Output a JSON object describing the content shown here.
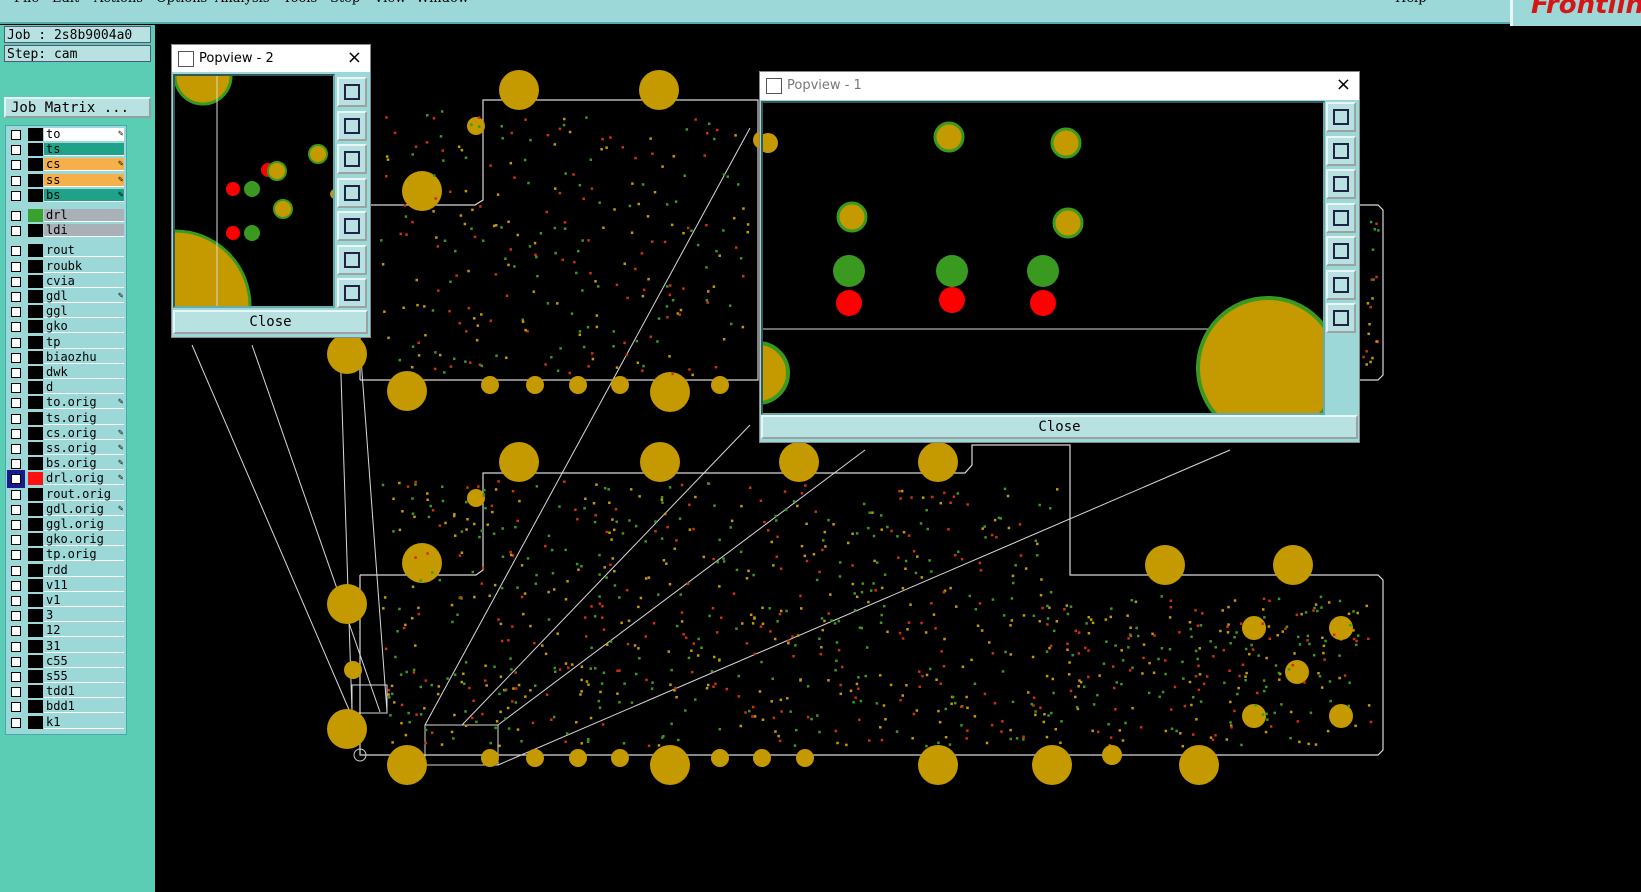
{
  "menu": {
    "items": [
      "File",
      "Edit",
      "Actions",
      "Options",
      "Analysis",
      "Tools",
      "Step",
      "View",
      "Window"
    ],
    "help": "Help"
  },
  "logo": "Frontline",
  "job": {
    "label": "Job : 2s8b9004a0",
    "step": "Step: cam",
    "matrix_button": "Job Matrix ..."
  },
  "layers": [
    {
      "name": "to",
      "color": "#ffffff",
      "edit": true
    },
    {
      "name": "ts",
      "color": "#1ea38a",
      "edit": false
    },
    {
      "name": "cs",
      "color": "#f6b04a",
      "edit": true
    },
    {
      "name": "ss",
      "color": "#f6b04a",
      "edit": true
    },
    {
      "name": "bs",
      "color": "#1ea38a",
      "edit": true
    },
    {
      "name": "drl",
      "color": "#aab0b8",
      "swatch": "#3aa030",
      "edit": false,
      "gap": true
    },
    {
      "name": "ldi",
      "color": "#aab0b8",
      "edit": false
    },
    {
      "name": "rout",
      "color": "#9dd8d8",
      "edit": false,
      "gap": true
    },
    {
      "name": "roubk",
      "color": "#9dd8d8",
      "edit": false
    },
    {
      "name": "cvia",
      "color": "#9dd8d8",
      "edit": false
    },
    {
      "name": "gdl",
      "color": "#9dd8d8",
      "edit": true
    },
    {
      "name": "ggl",
      "color": "#9dd8d8",
      "edit": false
    },
    {
      "name": "gko",
      "color": "#9dd8d8",
      "edit": false
    },
    {
      "name": "tp",
      "color": "#9dd8d8",
      "edit": false
    },
    {
      "name": "biaozhu",
      "color": "#9dd8d8",
      "edit": false
    },
    {
      "name": "dwk",
      "color": "#9dd8d8",
      "edit": false
    },
    {
      "name": "d",
      "color": "#9dd8d8",
      "edit": false
    },
    {
      "name": "to.orig",
      "color": "#9dd8d8",
      "edit": true
    },
    {
      "name": "ts.orig",
      "color": "#9dd8d8",
      "edit": false
    },
    {
      "name": "cs.orig",
      "color": "#9dd8d8",
      "edit": true
    },
    {
      "name": "ss.orig",
      "color": "#9dd8d8",
      "edit": true
    },
    {
      "name": "bs.orig",
      "color": "#9dd8d8",
      "edit": true
    },
    {
      "name": "drl.orig",
      "color": "#9dd8d8",
      "swatch": "#ff1010",
      "edit": true,
      "active": true
    },
    {
      "name": "rout.orig",
      "color": "#9dd8d8",
      "edit": false
    },
    {
      "name": "gdl.orig",
      "color": "#9dd8d8",
      "edit": true
    },
    {
      "name": "ggl.orig",
      "color": "#9dd8d8",
      "edit": false
    },
    {
      "name": "gko.orig",
      "color": "#9dd8d8",
      "edit": false
    },
    {
      "name": "tp.orig",
      "color": "#9dd8d8",
      "edit": false
    },
    {
      "name": "rdd",
      "color": "#9dd8d8",
      "edit": false
    },
    {
      "name": "v11",
      "color": "#9dd8d8",
      "edit": false
    },
    {
      "name": "v1",
      "color": "#9dd8d8",
      "edit": false
    },
    {
      "name": "3",
      "color": "#9dd8d8",
      "edit": false
    },
    {
      "name": "12",
      "color": "#9dd8d8",
      "edit": false
    },
    {
      "name": "31",
      "color": "#9dd8d8",
      "edit": false
    },
    {
      "name": "c55",
      "color": "#9dd8d8",
      "edit": false
    },
    {
      "name": "s55",
      "color": "#9dd8d8",
      "edit": false
    },
    {
      "name": "tdd1",
      "color": "#9dd8d8",
      "edit": false
    },
    {
      "name": "bdd1",
      "color": "#9dd8d8",
      "edit": false
    },
    {
      "name": "k1",
      "color": "#9dd8d8",
      "edit": false
    }
  ],
  "popview1": {
    "title": "Popview - 1",
    "close": "Close"
  },
  "popview2": {
    "title": "Popview - 2",
    "close": "Close"
  },
  "colors": {
    "pad": "#c49a00",
    "ring": "#3a9a20",
    "drill": "#ff0000",
    "outline": "#d8d8d8",
    "panel": "#5ccdb5",
    "button": "#b8e2e2"
  }
}
